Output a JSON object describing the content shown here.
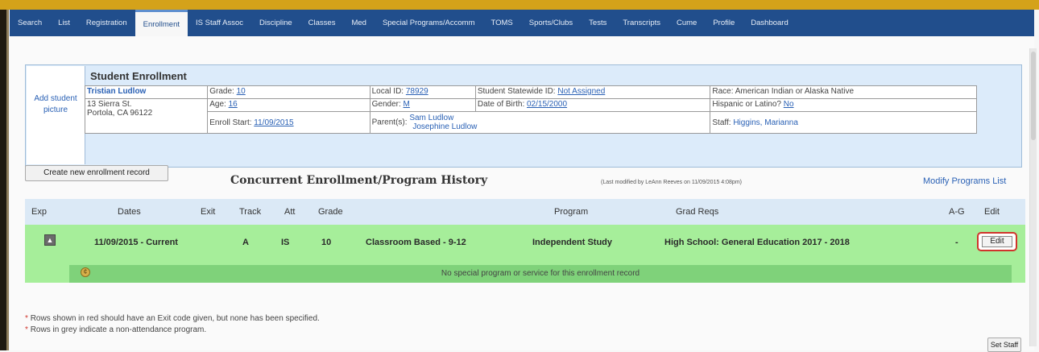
{
  "nav": {
    "tabs": [
      "Search",
      "List",
      "Registration",
      "Enrollment",
      "IS Staff Assoc",
      "Discipline",
      "Classes",
      "Med",
      "Special Programs/Accomm",
      "TOMS",
      "Sports/Clubs",
      "Tests",
      "Transcripts",
      "Cume",
      "Profile",
      "Dashboard"
    ],
    "active": "Enrollment"
  },
  "student": {
    "section_title": "Student Enrollment",
    "add_picture": "Add student picture",
    "name": "Tristian Ludlow",
    "address1": "13 Sierra St.",
    "address2": "Portola, CA 96122",
    "grade_label": "Grade:",
    "grade": "10",
    "age_label": "Age:",
    "age": "16",
    "enroll_label": "Enroll Start:",
    "enroll_start": "11/09/2015",
    "localid_label": "Local ID:",
    "local_id": "78929",
    "gender_label": "Gender:",
    "gender": "M",
    "parents_label": "Parent(s):",
    "parent1": "Sam Ludlow",
    "parent2": "Josephine Ludlow",
    "ssid_label": "Student Statewide ID:",
    "ssid": "Not Assigned",
    "dob_label": "Date of Birth:",
    "dob": "02/15/2000",
    "race_label": "Race:",
    "race": "American Indian or Alaska Native",
    "hispanic_label": "Hispanic or Latino?",
    "hispanic": "No",
    "staff_label": "Staff:",
    "staff": "Higgins, Marianna"
  },
  "actions": {
    "create": "Create new enrollment record",
    "modify": "Modify Programs List",
    "set_staff": "Set Staff"
  },
  "history": {
    "title": "Concurrent Enrollment/Program History",
    "last_modified": "(Last modified by LeAnn Reeves on 11/09/2015 4:08pm)",
    "columns": [
      "Exp",
      "Dates",
      "Exit",
      "Track",
      "Att",
      "Grade",
      "Program",
      "Grad Reqs",
      "A-G",
      "Edit"
    ],
    "row": {
      "dates": "11/09/2015 - Current",
      "exit": "",
      "track": "A",
      "att": "IS",
      "grade": "10",
      "school": "Classroom Based - 9-12",
      "program": "Independent Study",
      "grad_reqs": "High School: General Education 2017 - 2018",
      "ag": "-",
      "edit": "Edit"
    },
    "no_special": "No special program or service for this enrollment record"
  },
  "notes": [
    "Rows shown in red should have an Exit code given, but none has been specified.",
    "Rows in grey indicate a non-attendance program."
  ],
  "colors": {
    "nav_bg": "#214e8c",
    "row_green": "#a6ee9a",
    "edit_highlight": "#d0342c"
  }
}
